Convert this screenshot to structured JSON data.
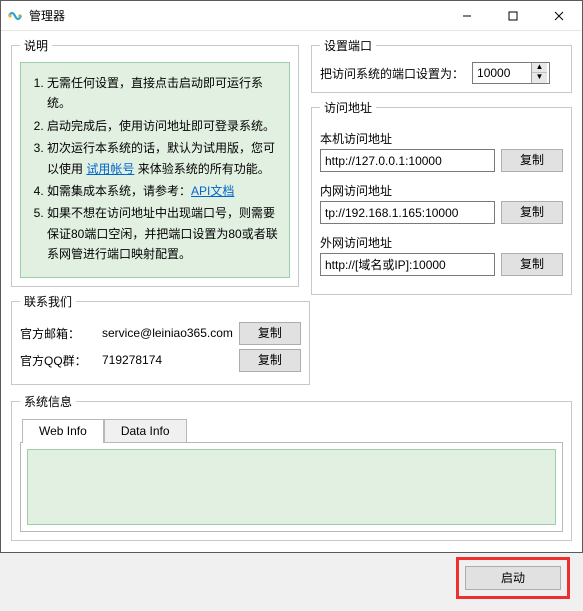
{
  "window": {
    "title": "管理器"
  },
  "instructions": {
    "legend": "说明",
    "items": [
      {
        "text": "无需任何设置，直接点击启动即可运行系统。"
      },
      {
        "text": "启动完成后，使用访问地址即可登录系统。"
      },
      {
        "prefix": "初次运行本系统的话，默认为试用版，您可以使用 ",
        "link": "试用帐号",
        "suffix": " 来体验系统的所有功能。"
      },
      {
        "prefix": "如需集成本系统，请参考：",
        "link": "API文档",
        "suffix": ""
      },
      {
        "text": "如果不想在访问地址中出现端口号，则需要保证80端口空闲，并把端口设置为80或者联系网管进行端口映射配置。"
      }
    ]
  },
  "contact": {
    "legend": "联系我们",
    "email_label": "官方邮箱：",
    "email_value": "service@leiniao365.com",
    "qq_label": "官方QQ群：",
    "qq_value": "719278174",
    "copy": "复制"
  },
  "sysinfo": {
    "legend": "系统信息",
    "tabs": {
      "web": "Web Info",
      "data": "Data Info"
    }
  },
  "port": {
    "legend": "设置端口",
    "label": "把访问系统的端口设置为：",
    "value": "10000"
  },
  "address": {
    "legend": "访问地址",
    "local_label": "本机访问地址",
    "local_value": "http://127.0.0.1:10000",
    "lan_label": "内网访问地址",
    "lan_value": "tp://192.168.1.165:10000",
    "wan_label": "外网访问地址",
    "wan_value": "http://[域名或IP]:10000",
    "copy": "复制"
  },
  "footer": {
    "start": "启动"
  }
}
